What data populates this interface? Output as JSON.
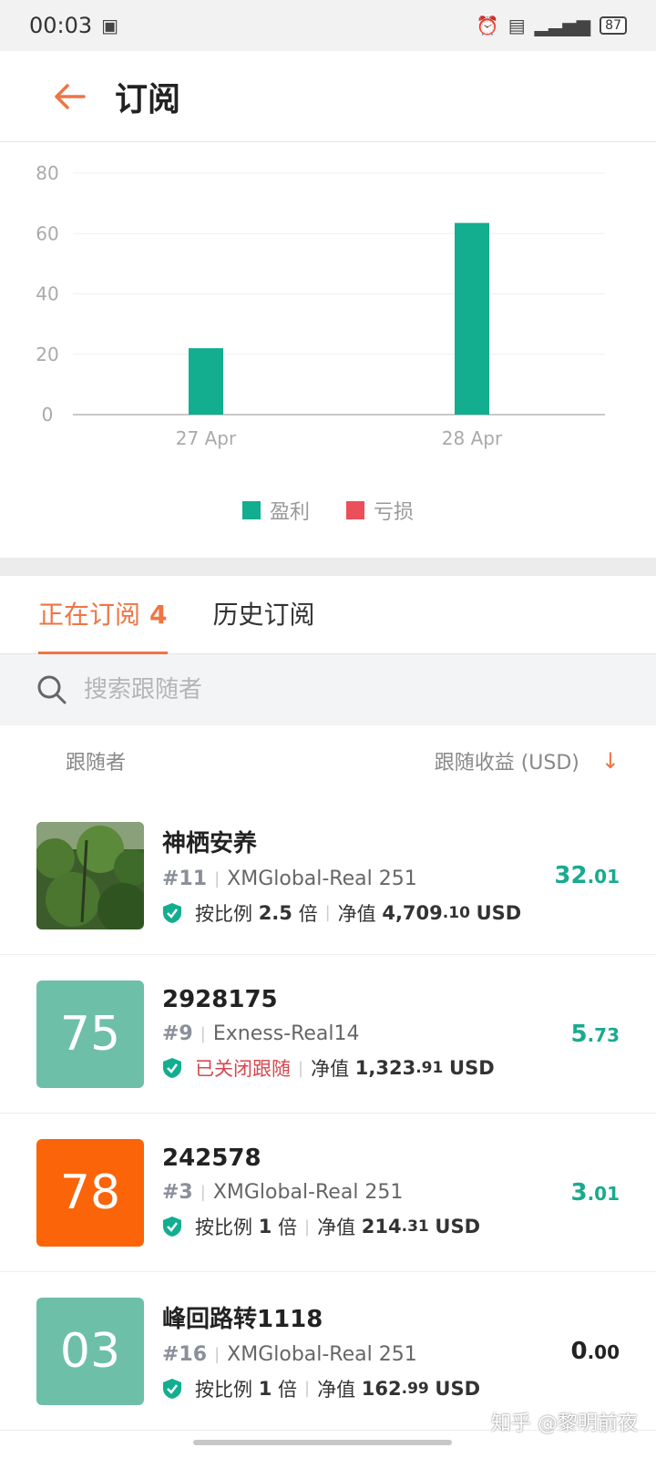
{
  "status_bar": {
    "time": "00:03",
    "battery": "87"
  },
  "header": {
    "title": "订阅"
  },
  "chart_data": {
    "type": "bar",
    "categories": [
      "27 Apr",
      "28 Apr"
    ],
    "series": [
      {
        "name": "盈利",
        "values": [
          22,
          63.5
        ],
        "color": "#12ae8f"
      },
      {
        "name": "亏损",
        "values": [
          0,
          0
        ],
        "color": "#ea4f5a"
      }
    ],
    "yticks": [
      "0",
      "20",
      "40",
      "60",
      "80"
    ],
    "ylim": [
      0,
      80
    ],
    "grid": true,
    "legend_position": "bottom"
  },
  "tabs": {
    "active": {
      "label": "正在订阅",
      "count": "4"
    },
    "history": {
      "label": "历史订阅"
    }
  },
  "search": {
    "placeholder": "搜索跟随者"
  },
  "list_header": {
    "left": "跟随者",
    "right": "跟随收益 (USD)"
  },
  "rows": [
    {
      "name": "神栖安养",
      "rank": "#11",
      "account": "XMGlobal-Real 251",
      "mode": "按比例",
      "ratio": "2.5",
      "ratio_unit": "倍",
      "equity_label": "净值",
      "equity_int": "4,709",
      "equity_dec": ".10",
      "currency": "USD",
      "profit_int": "32",
      "profit_dec": ".01",
      "avatar_text": "",
      "avatar_color": "#3e6a2a"
    },
    {
      "name": "2928175",
      "rank": "#9",
      "account": "Exness-Real14",
      "status": "已关闭跟随",
      "equity_label": "净值",
      "equity_int": "1,323",
      "equity_dec": ".91",
      "currency": "USD",
      "profit_int": "5",
      "profit_dec": ".73",
      "avatar_text": "75",
      "avatar_color": "#6dbfa8"
    },
    {
      "name": "242578",
      "rank": "#3",
      "account": "XMGlobal-Real 251",
      "mode": "按比例",
      "ratio": "1",
      "ratio_unit": "倍",
      "equity_label": "净值",
      "equity_int": "214",
      "equity_dec": ".31",
      "currency": "USD",
      "profit_int": "3",
      "profit_dec": ".01",
      "avatar_text": "78",
      "avatar_color": "#fb6408"
    },
    {
      "name": "峰回路转1118",
      "rank": "#16",
      "account": "XMGlobal-Real 251",
      "mode": "按比例",
      "ratio": "1",
      "ratio_unit": "倍",
      "equity_label": "净值",
      "equity_int": "162",
      "equity_dec": ".99",
      "currency": "USD",
      "profit_int": "0",
      "profit_dec": ".00",
      "avatar_text": "03",
      "avatar_color": "#6dbfa8"
    }
  ],
  "watermark": "知乎 @黎明前夜"
}
